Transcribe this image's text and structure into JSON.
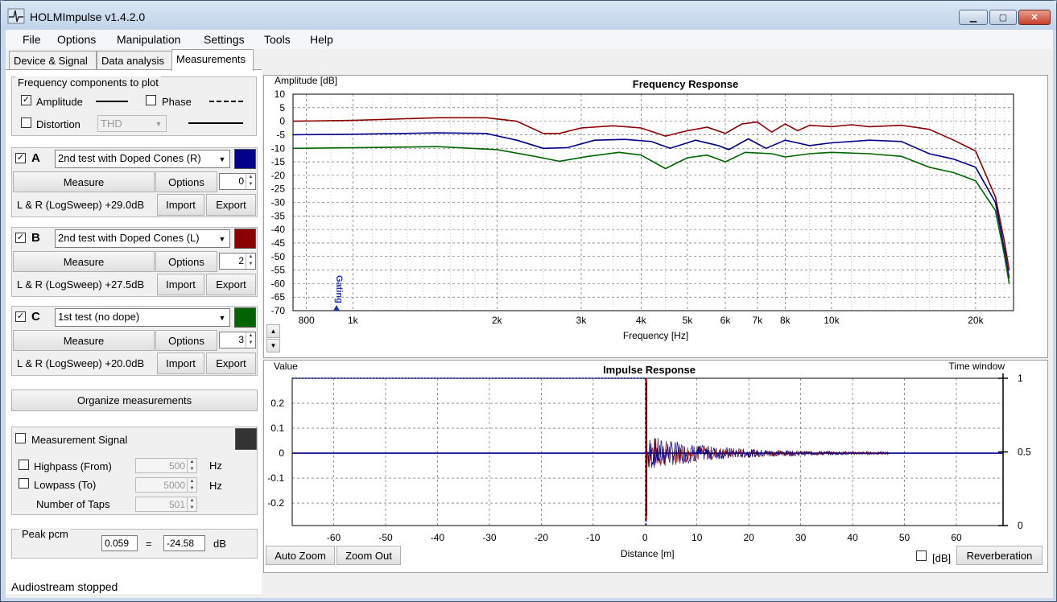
{
  "window": {
    "title": "HOLMImpulse  v1.4.2.0",
    "min_glyph": "▁",
    "max_glyph": "▢",
    "close_glyph": "✕"
  },
  "menu": [
    "File",
    "Options",
    "Manipulation",
    "Settings",
    "Tools",
    "Help"
  ],
  "tabs": [
    "Device & Signal",
    "Data analysis",
    "Measurements"
  ],
  "active_tab": "Measurements",
  "freq_components": {
    "title": "Frequency components to plot",
    "amplitude": {
      "label": "Amplitude",
      "checked": true
    },
    "phase": {
      "label": "Phase",
      "checked": false
    },
    "distortion": {
      "label": "Distortion",
      "checked": false
    },
    "distortion_select": "THD"
  },
  "check_glyph": "✓",
  "measurements": [
    {
      "letter": "A",
      "name": "2nd test with Doped Cones (R)",
      "color": "#00008b",
      "measure": "Measure",
      "options": "Options",
      "smoothing": "0",
      "info": "L & R (LogSweep) +29.0dB",
      "import": "Import",
      "export": "Export"
    },
    {
      "letter": "B",
      "name": "2nd test with Doped Cones (L)",
      "color": "#8b0000",
      "measure": "Measure",
      "options": "Options",
      "smoothing": "2",
      "info": "L & R (LogSweep) +27.5dB",
      "import": "Import",
      "export": "Export"
    },
    {
      "letter": "C",
      "name": "1st test (no dope)",
      "color": "#006400",
      "measure": "Measure",
      "options": "Options",
      "smoothing": "3",
      "info": "L & R (LogSweep) +20.0dB",
      "import": "Import",
      "export": "Export"
    }
  ],
  "organize": "Organize measurements",
  "signal": {
    "label": "Measurement Signal",
    "color": "#333333",
    "highpass": {
      "label": "Highpass (From)",
      "value": "500",
      "unit": "Hz"
    },
    "lowpass": {
      "label": "Lowpass (To)",
      "value": "5000",
      "unit": "Hz"
    },
    "taps": {
      "label": "Number of Taps",
      "value": "501"
    }
  },
  "peak": {
    "label": "Peak pcm",
    "value": "0.059",
    "eq": "=",
    "db_value": "-24.58",
    "unit": "dB"
  },
  "freq_plot": {
    "title": "Frequency Response",
    "ylabel": "Amplitude [dB]",
    "xlabel": "Frequency [Hz]",
    "gating_label": "Gating"
  },
  "impulse_plot": {
    "title": "Impulse Response",
    "ylabel": "Value",
    "xlabel": "Distance [m]",
    "right_label": "Time window",
    "auto_zoom": "Auto Zoom",
    "zoom_out": "Zoom Out",
    "db_label": "[dB]",
    "reverb": "Reverberation"
  },
  "status": "Audiostream stopped",
  "chart_data": [
    {
      "type": "line",
      "title": "Frequency Response",
      "xlabel": "Frequency [Hz]",
      "ylabel": "Amplitude [dB]",
      "xscale": "log",
      "xlim": [
        750,
        24000
      ],
      "ylim": [
        -70,
        10
      ],
      "yticks": [
        10,
        5,
        0,
        -5,
        -10,
        -15,
        -20,
        -25,
        -30,
        -35,
        -40,
        -45,
        -50,
        -55,
        -60,
        -65,
        -70
      ],
      "xticks": [
        {
          "v": 800,
          "l": "800"
        },
        {
          "v": 1000,
          "l": "1k"
        },
        {
          "v": 2000,
          "l": "2k"
        },
        {
          "v": 3000,
          "l": "3k"
        },
        {
          "v": 4000,
          "l": "4k"
        },
        {
          "v": 5000,
          "l": "5k"
        },
        {
          "v": 6000,
          "l": "6k"
        },
        {
          "v": 7000,
          "l": "7k"
        },
        {
          "v": 8000,
          "l": "8k"
        },
        {
          "v": 10000,
          "l": "10k"
        },
        {
          "v": 20000,
          "l": "20k"
        }
      ],
      "grid": true,
      "series": [
        {
          "color": "#8b0000",
          "points": [
            [
              750,
              0
            ],
            [
              1000,
              0.3
            ],
            [
              1500,
              1.3
            ],
            [
              1900,
              1.3
            ],
            [
              2200,
              0
            ],
            [
              2500,
              -4.5
            ],
            [
              2700,
              -4.5
            ],
            [
              3000,
              -2.5
            ],
            [
              3500,
              -1.7
            ],
            [
              4000,
              -2.5
            ],
            [
              4500,
              -5.5
            ],
            [
              5000,
              -3.5
            ],
            [
              5500,
              -2.2
            ],
            [
              6000,
              -4.5
            ],
            [
              6500,
              -1
            ],
            [
              7000,
              -0.3
            ],
            [
              7500,
              -4
            ],
            [
              8000,
              -1
            ],
            [
              8500,
              -3.5
            ],
            [
              9000,
              -1.5
            ],
            [
              10000,
              -2
            ],
            [
              11000,
              -1.3
            ],
            [
              12000,
              -2
            ],
            [
              14000,
              -1.5
            ],
            [
              16000,
              -3
            ],
            [
              18000,
              -7
            ],
            [
              20000,
              -11
            ],
            [
              22000,
              -28
            ],
            [
              23000,
              -45
            ],
            [
              23500,
              -55
            ]
          ]
        },
        {
          "color": "#00008b",
          "points": [
            [
              750,
              -5
            ],
            [
              1000,
              -4.8
            ],
            [
              1500,
              -4.3
            ],
            [
              1900,
              -4.5
            ],
            [
              2200,
              -7
            ],
            [
              2500,
              -10
            ],
            [
              2800,
              -9.8
            ],
            [
              3200,
              -7
            ],
            [
              3700,
              -6.7
            ],
            [
              4200,
              -7.5
            ],
            [
              4600,
              -10
            ],
            [
              5200,
              -7
            ],
            [
              5800,
              -9
            ],
            [
              6100,
              -10.5
            ],
            [
              6700,
              -6.5
            ],
            [
              7300,
              -10
            ],
            [
              8000,
              -7
            ],
            [
              9000,
              -9
            ],
            [
              10000,
              -8
            ],
            [
              12000,
              -7
            ],
            [
              14000,
              -7.5
            ],
            [
              16000,
              -12
            ],
            [
              18000,
              -14
            ],
            [
              20000,
              -17
            ],
            [
              22000,
              -30
            ],
            [
              23000,
              -48
            ],
            [
              23500,
              -58
            ]
          ]
        },
        {
          "color": "#006400",
          "points": [
            [
              750,
              -10
            ],
            [
              1000,
              -9.8
            ],
            [
              1500,
              -9.4
            ],
            [
              2000,
              -10.5
            ],
            [
              2400,
              -13
            ],
            [
              2700,
              -14.8
            ],
            [
              3100,
              -13
            ],
            [
              3600,
              -11.5
            ],
            [
              4000,
              -12.5
            ],
            [
              4500,
              -17.5
            ],
            [
              5000,
              -13.5
            ],
            [
              5500,
              -12.5
            ],
            [
              6000,
              -15
            ],
            [
              6600,
              -11.5
            ],
            [
              7500,
              -12
            ],
            [
              8000,
              -13.2
            ],
            [
              9000,
              -12
            ],
            [
              10000,
              -11.5
            ],
            [
              12000,
              -12
            ],
            [
              14000,
              -13
            ],
            [
              16000,
              -17
            ],
            [
              18000,
              -19
            ],
            [
              20000,
              -22
            ],
            [
              22000,
              -33
            ],
            [
              23000,
              -50
            ],
            [
              23500,
              -60
            ]
          ]
        }
      ]
    },
    {
      "type": "line",
      "title": "Impulse Response",
      "xlabel": "Distance [m]",
      "ylabel": "Value",
      "xlim": [
        -68,
        69
      ],
      "ylim": [
        -0.29,
        0.3
      ],
      "xticks": [
        -60,
        -50,
        -40,
        -30,
        -20,
        -10,
        0,
        10,
        20,
        30,
        40,
        50,
        60
      ],
      "yticks": [
        0.2,
        0.1,
        0,
        -0.1,
        -0.2
      ],
      "right_axis": {
        "label": "Time window",
        "ticks": [
          1,
          0.5,
          0
        ]
      },
      "grid": true,
      "peak": {
        "x": 0.2,
        "y": 0.3
      },
      "decay_end": 47
    }
  ]
}
